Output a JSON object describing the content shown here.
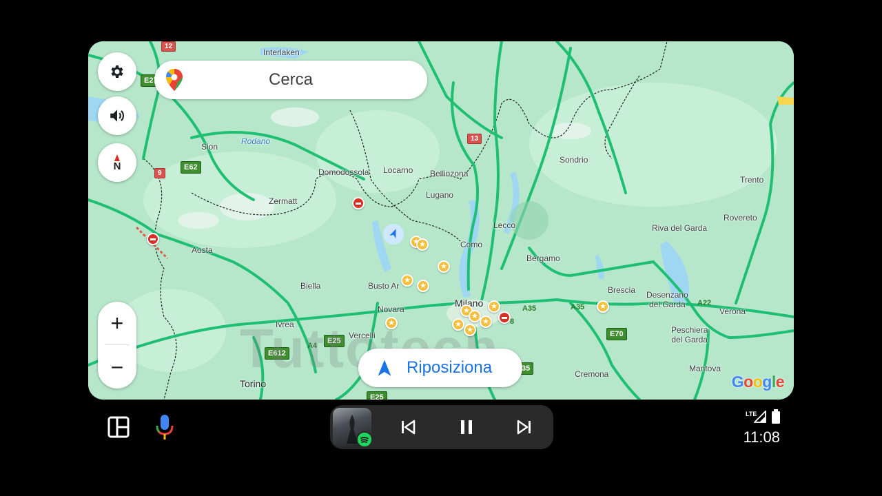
{
  "map": {
    "search_placeholder": "Cerca",
    "recenter_label": "Riposiziona",
    "watermark": "Tuttotech",
    "logo": [
      "G",
      "o",
      "o",
      "g",
      "l",
      "e"
    ],
    "logo_colors": [
      "#4285F4",
      "#EA4335",
      "#FBBC05",
      "#4285F4",
      "#34A853",
      "#EA4335"
    ],
    "zoom_in": "+",
    "zoom_out": "−",
    "compass_letter": "N",
    "places": {
      "interlaken": "Interlaken",
      "sion": "Sion",
      "rodano": "Rodano",
      "domodossola": "Domodossola",
      "locarno": "Locarno",
      "bellinzona": "Bellinzona",
      "lugano": "Lugano",
      "zermatt": "Zermatt",
      "sondrio": "Sondrio",
      "trento": "Trento",
      "rovereto": "Rovereto",
      "riva": "Riva del Garda",
      "lecco": "Lecco",
      "como": "Como",
      "bergamo": "Bergamo",
      "aosta": "Aosta",
      "biella": "Biella",
      "busto": "Busto Ar",
      "novara": "Novara",
      "milano": "Milano",
      "brescia": "Brescia",
      "desenzano": "Desenzano\ndel Garda",
      "verona": "Verona",
      "ivrea": "Ivrea",
      "vercelli": "Vercelli",
      "peschiera": "Peschiera\ndel Garda",
      "cremona": "Cremona",
      "mantova": "Mantova",
      "torino": "Torino"
    },
    "shields": {
      "s12": "12",
      "e27": "E27",
      "s9": "9",
      "e62": "E62",
      "s13": "13",
      "a35a": "A35",
      "a35b": "A35",
      "a22": "A22",
      "e70": "E70",
      "a4": "A4",
      "e25a": "E25",
      "e612": "E612",
      "s35": "35",
      "e25b": "E25",
      "s8": "8"
    }
  },
  "bottom_bar": {
    "time": "11:08",
    "network": "LTE"
  },
  "colors": {
    "map_bg": "#b3e6c9",
    "road": "#1fbf73",
    "accent": "#1a73e8",
    "star": "#f5bf3d"
  }
}
